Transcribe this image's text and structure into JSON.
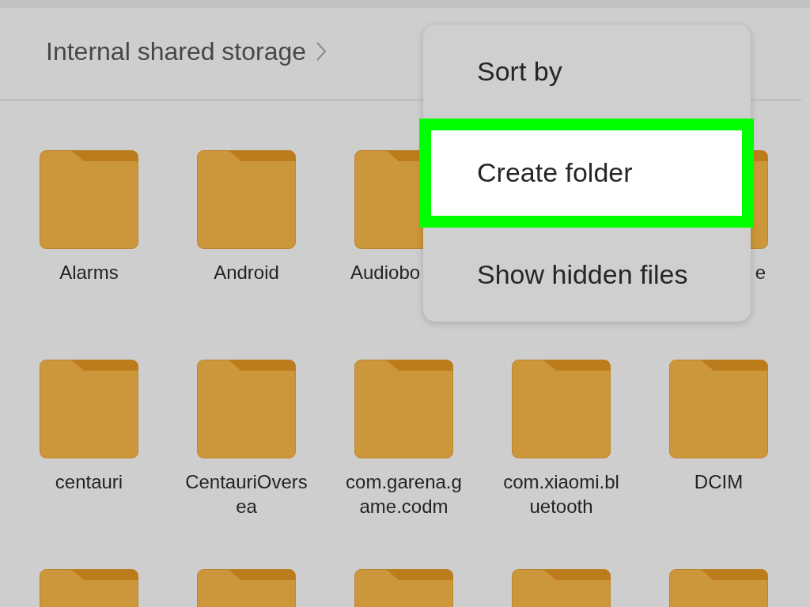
{
  "breadcrumb": {
    "path": "Internal shared storage"
  },
  "folders": [
    {
      "kind": "folder",
      "label": "Alarms"
    },
    {
      "kind": "folder",
      "label": "Android"
    },
    {
      "kind": "folder",
      "label": "Audiobo",
      "covered_right": true
    },
    {
      "kind": "covered"
    },
    {
      "kind": "folder",
      "label": "e",
      "covered_left": true
    },
    {
      "kind": "folder",
      "label": "centauri"
    },
    {
      "kind": "folder",
      "label": "CentauriOversea"
    },
    {
      "kind": "folder",
      "label": "com.garena.game.codm"
    },
    {
      "kind": "folder",
      "label": "com.xiaomi.bluetooth"
    },
    {
      "kind": "folder",
      "label": "DCIM"
    },
    {
      "kind": "folder"
    },
    {
      "kind": "folder"
    },
    {
      "kind": "folder"
    },
    {
      "kind": "folder"
    },
    {
      "kind": "folder"
    }
  ],
  "menu": {
    "items": [
      {
        "label": "Sort by",
        "highlighted": false
      },
      {
        "label": "Create folder",
        "highlighted": true
      },
      {
        "label": "Show hidden files",
        "highlighted": false
      }
    ]
  }
}
